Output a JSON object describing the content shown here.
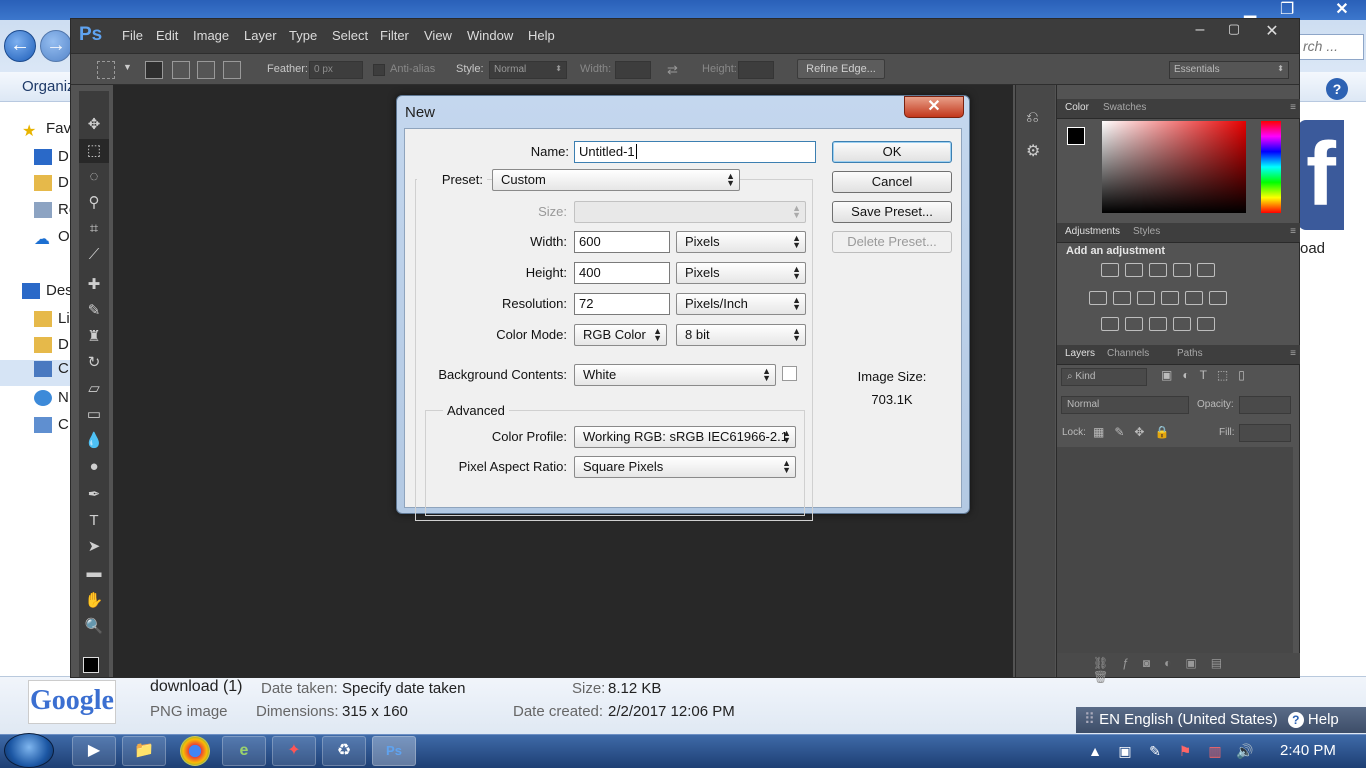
{
  "explorer": {
    "organize": "Organiz",
    "search_placeholder": "rch ...",
    "sidebar_items": [
      "Fav",
      "D",
      "D",
      "Re",
      "O",
      "Des",
      "Li",
      "D",
      "C",
      "N",
      "C"
    ],
    "right_panel_text": "oad",
    "status": {
      "filename": "download (1)",
      "filetype": "PNG image",
      "date_taken_label": "Date taken:",
      "date_taken_value": "Specify date taken",
      "dimensions_label": "Dimensions:",
      "dimensions_value": "315 x 160",
      "size_label": "Size:",
      "size_value": "8.12 KB",
      "date_created_label": "Date created:",
      "date_created_value": "2/2/2017 12:06 PM",
      "thumb_text": "Google"
    },
    "language_bar": {
      "lang": "EN English (United States)",
      "help": "Help"
    }
  },
  "taskbar": {
    "clock": "2:40 PM",
    "buttons": [
      "media-player",
      "explorer",
      "chrome",
      "eclipse",
      "adobe",
      "recycle",
      "photoshop"
    ]
  },
  "photoshop": {
    "logo": "Ps",
    "menu": [
      "File",
      "Edit",
      "Image",
      "Layer",
      "Type",
      "Select",
      "Filter",
      "View",
      "Window",
      "Help"
    ],
    "options": {
      "feather_label": "Feather:",
      "feather_value": "0 px",
      "antialias_label": "Anti-alias",
      "style_label": "Style:",
      "style_value": "Normal",
      "width_label": "Width:",
      "height_label": "Height:",
      "refine_edge": "Refine Edge...",
      "workspace": "Essentials"
    },
    "panels": {
      "color_tabs": [
        "Color",
        "Swatches"
      ],
      "adjust_tabs": [
        "Adjustments",
        "Styles"
      ],
      "add_adjustment": "Add an adjustment",
      "layers_tabs": [
        "Layers",
        "Channels",
        "Paths"
      ],
      "kind": "Kind",
      "blend_mode": "Normal",
      "opacity_label": "Opacity:",
      "lock_label": "Lock:",
      "fill_label": "Fill:"
    }
  },
  "dialog": {
    "title": "New",
    "name_label": "Name:",
    "name_value": "Untitled-1",
    "preset_label": "Preset:",
    "preset_value": "Custom",
    "size_label": "Size:",
    "width_label": "Width:",
    "width_value": "600",
    "width_unit": "Pixels",
    "height_label": "Height:",
    "height_value": "400",
    "height_unit": "Pixels",
    "resolution_label": "Resolution:",
    "resolution_value": "72",
    "resolution_unit": "Pixels/Inch",
    "color_mode_label": "Color Mode:",
    "color_mode_value": "RGB Color",
    "bit_depth": "8 bit",
    "bg_contents_label": "Background Contents:",
    "bg_contents_value": "White",
    "advanced_label": "Advanced",
    "color_profile_label": "Color Profile:",
    "color_profile_value": "Working RGB:  sRGB IEC61966-2.1",
    "pixel_aspect_label": "Pixel Aspect Ratio:",
    "pixel_aspect_value": "Square Pixels",
    "ok": "OK",
    "cancel": "Cancel",
    "save_preset": "Save Preset...",
    "delete_preset": "Delete Preset...",
    "image_size_label": "Image Size:",
    "image_size_value": "703.1K"
  }
}
